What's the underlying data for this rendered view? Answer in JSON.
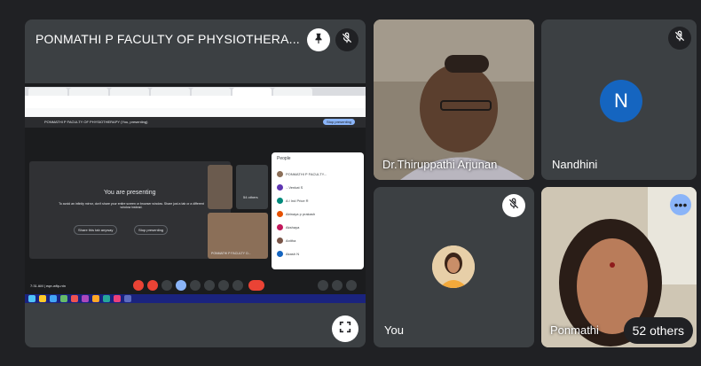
{
  "presentation": {
    "title": "PONMATHI P FACULTY OF PHYSIOTHERA...",
    "shared_screen": {
      "meet_bar_text": "PONMATHI P FACULTY OF PHYSIOTHERAPY (You, presenting)",
      "stop_presenting_label": "Stop presenting",
      "presenting_heading": "You are presenting",
      "presenting_subtext": "To avoid an infinity mirror, don't share your entire screen or browser window. Share just a tab or a different window instead.",
      "share_tab_label": "Share this tab anyway",
      "stop_label": "Stop presenting",
      "inner_others_label": "54 others",
      "inner_tile_name": "PONMATHI P FACULTY O...",
      "people_panel": {
        "title": "People",
        "rows": [
          "PONMATHI P FACULTY...",
          "...Venkat S",
          "A I Ind Price R",
          "Abinaya p prakash",
          "Akshaya",
          "Anitha",
          "Akash N"
        ]
      },
      "clock_text": "7:31 AM | eqe-wfip-ntn"
    }
  },
  "participants": [
    {
      "name": "Dr.Thiruppathi Arjunan"
    },
    {
      "name": "Nandhini",
      "initial": "N"
    },
    {
      "name": "You"
    },
    {
      "name": "Ponmathi",
      "others_label": "52 others",
      "more_icon": "•••"
    }
  ],
  "colors": {
    "background": "#202124",
    "tile": "#3c4043",
    "avatar_blue": "#1565c0",
    "meet_accent": "#8ab4f8",
    "hangup_red": "#ea4335"
  }
}
